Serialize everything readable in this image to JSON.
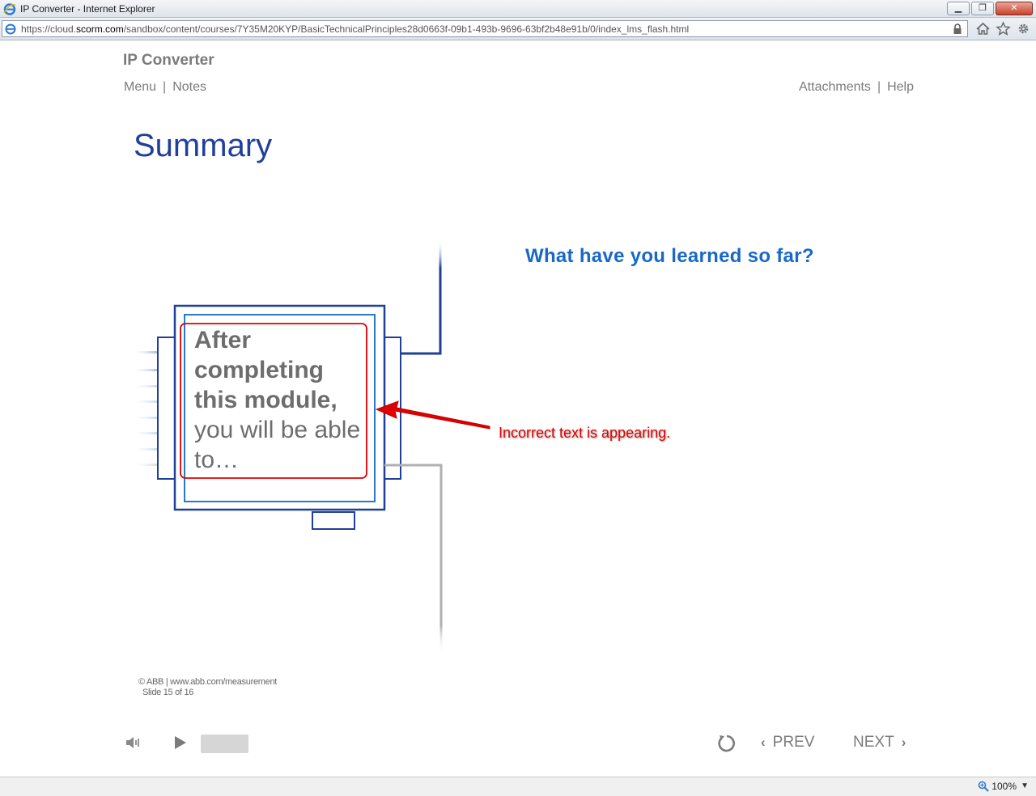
{
  "browser": {
    "window_title": "IP Converter - Internet Explorer",
    "url_prefix": "https://cloud.",
    "url_domain": "scorm.com",
    "url_rest": "/sandbox/content/courses/7Y35M20KYP/BasicTechnicalPrinciples28d0663f-09b1-493b-9696-63bf2b48e91b/0/index_lms_flash.html",
    "zoom": "100%"
  },
  "course": {
    "title": "IP Converter",
    "nav_left": [
      "Menu",
      "Notes"
    ],
    "nav_right": [
      "Attachments",
      "Help"
    ]
  },
  "slide": {
    "heading": "Summary",
    "question": "What have you learned so far?",
    "chip_text_bold": [
      "After",
      "completing",
      "this module,"
    ],
    "chip_text_regular": [
      "you will be able",
      "to…"
    ],
    "annotation": "Incorrect text is appearing.",
    "copyright": "© ABB | www.abb.com/measurement",
    "slide_counter": "Slide 15 of 16"
  },
  "controls": {
    "prev_label": "PREV",
    "next_label": "NEXT"
  },
  "colors": {
    "brand_blue": "#1f3f9a",
    "question_blue": "#1768c8",
    "annotation_red": "#e00000"
  }
}
